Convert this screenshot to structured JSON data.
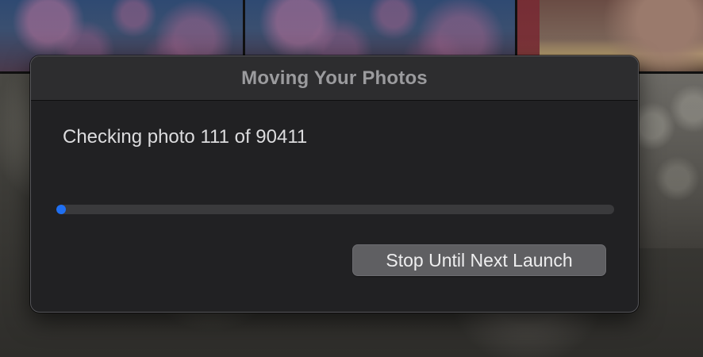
{
  "dialog": {
    "title": "Moving Your Photos",
    "status_text": "Checking photo 111 of 90411",
    "progress": {
      "current": 111,
      "total": 90411,
      "fraction": 0.0012,
      "color": "#1f6ff2"
    },
    "stop_button_label": "Stop Until Next Launch"
  },
  "background": {
    "description_colors": {
      "accent": "#1f6ff2",
      "dialog_bg": "#212123",
      "title_text": "#9b9b9e"
    }
  }
}
